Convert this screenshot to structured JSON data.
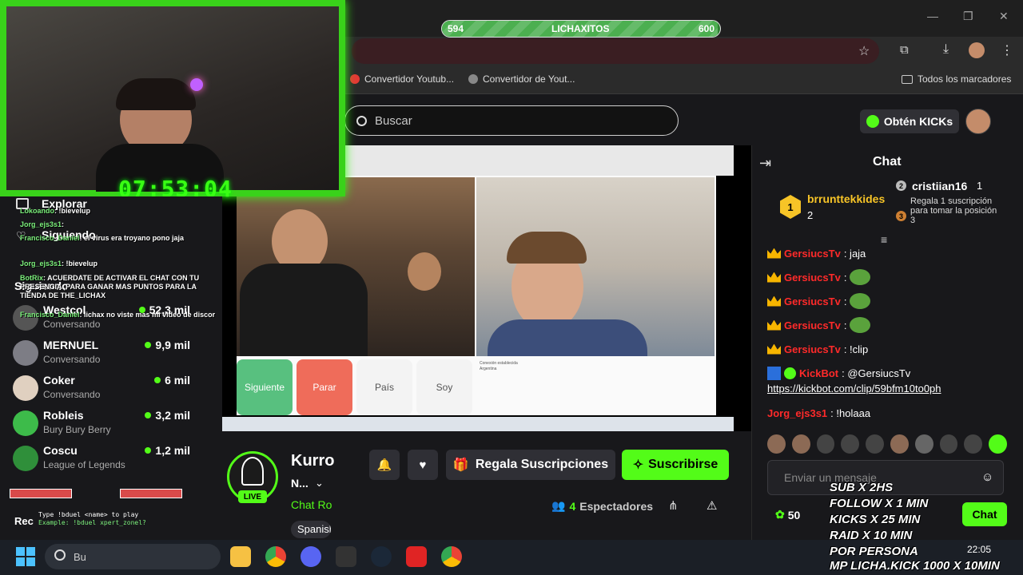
{
  "browser": {
    "bookmarks": [
      "Convertidor Youtub...",
      "Convertidor de Yout..."
    ],
    "all_bookmarks": "Todos los marcadores"
  },
  "kick": {
    "search_placeholder": "Buscar",
    "get_kicks_label": "Obtén KICKs"
  },
  "goal_bar": {
    "start": "594",
    "label": "LICHAXITOS",
    "end": "600",
    "progress_fraction": 0.99
  },
  "overlay": {
    "timer": "07:53:04",
    "chat_lines": [
      {
        "user": "Lokoando",
        "text": ": !bievelup"
      },
      {
        "user": "Jorg_ejs3s1",
        "text": ":"
      },
      {
        "user": "Francisco_Daniel",
        "text": ": el virus era troyano pono jaja"
      },
      {
        "user": "Jorg_ejs3s1",
        "text": ": !bievelup"
      },
      {
        "user": "BotRix",
        "text": ": ACUERDATE DE ACTIVAR EL CHAT CON TU PRESENCIA ,PARA GANAR MAS PUNTOS PARA LA TIENDA DE THE_LICHAX"
      },
      {
        "user": "Francisco_Daniel",
        "text": ": lichax no viste mas mi video de discor"
      }
    ]
  },
  "sidebar": {
    "explore": "Explorar",
    "following_top": "Siguiendo",
    "following": "Siguiendo",
    "recommended": "Rec",
    "channels": [
      {
        "name": "Westcol",
        "sub": "Conversando",
        "viewers": "52,3 mil"
      },
      {
        "name": "MERNUEL",
        "sub": "Conversando",
        "viewers": "9,9 mil"
      },
      {
        "name": "Coker",
        "sub": "Conversando",
        "viewers": "6 mil"
      },
      {
        "name": "Robleis",
        "sub": "Bury Bury Berry",
        "viewers": "3,2 mil"
      },
      {
        "name": "Coscu",
        "sub": "League of Legends",
        "viewers": "1,2 mil"
      }
    ],
    "duel_hint": "Type !bduel <name> to play",
    "duel_example": "Example: !bduel xpert_zonel?"
  },
  "video": {
    "buttons": {
      "next": "Siguiente",
      "stop": "Parar",
      "country": "País",
      "soy": "Soy"
    },
    "connection_text": "Conexión establecida",
    "connection_country": "Argentina"
  },
  "streamer": {
    "name": "Kurro",
    "title": "N...",
    "category": "Chat Ro",
    "language": "Spanish",
    "live": "LIVE",
    "gift_label": "Regala Suscripciones",
    "subscribe_label": "Suscribirse",
    "viewers_count": "4",
    "viewers_label": "Espectadores"
  },
  "chat": {
    "title": "Chat",
    "leaderboard": [
      {
        "rank": "1",
        "name": "brrunttekkides",
        "count": "2"
      },
      {
        "rank": "2",
        "name": "cristiian16",
        "count": "1"
      },
      {
        "rank": "3",
        "text": "Regala 1 suscripción para tomar la posición 3"
      }
    ],
    "messages": [
      {
        "user": "GersiucsTv",
        "text": ": jaja"
      },
      {
        "user": "GersiucsTv",
        "text": ":"
      },
      {
        "user": "GersiucsTv",
        "text": ":"
      },
      {
        "user": "GersiucsTv",
        "text": ":"
      },
      {
        "user": "GersiucsTv",
        "text": ": !clip"
      },
      {
        "user": "KickBot",
        "text": ": @GersiucsTv"
      },
      {
        "user": "Jorg_ejs3s1",
        "text": ": !holaaa"
      }
    ],
    "link": "https://kickbot.com/clip/59bfm10to0ph",
    "input_placeholder": "Enviar un mensaje",
    "points": "50",
    "send_label": "Chat"
  },
  "promo_lines": [
    "SUB X 2HS",
    "FOLLOW X 1 MIN",
    "KICKS X 25 MIN",
    "RAID X 10 MIN",
    "POR PERSONA",
    "MP LICHA.KICK 1000 X 10MIN"
  ],
  "taskbar": {
    "search": "Bu",
    "time": "22:05"
  }
}
